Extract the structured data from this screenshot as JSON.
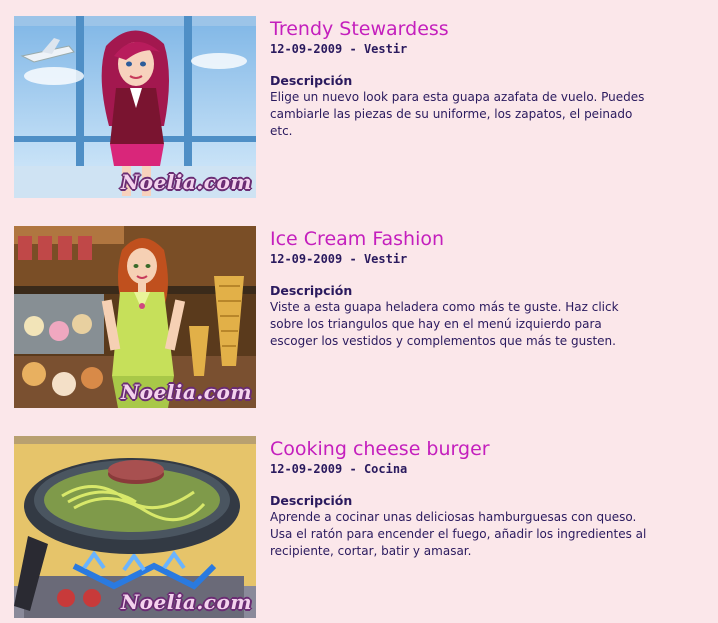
{
  "games": [
    {
      "title": "Trendy Stewardess",
      "date": "12-09-2009",
      "separator": " - ",
      "category": "Vestir",
      "description_label": "Descripción",
      "description": "Elige un nuevo look para esta guapa azafata de vuelo. Puedes\ncambiarle las piezas de su uniforme, los zapatos, el peinado\netc.",
      "logo": "Noelia.com"
    },
    {
      "title": "Ice Cream Fashion",
      "date": "12-09-2009",
      "separator": " - ",
      "category": "Vestir",
      "description_label": "Descripción",
      "description": "Viste a esta guapa heladera como más te guste. Haz click\nsobre los triangulos que hay en el menú izquierdo para\nescoger los vestidos y complementos que más te gusten.",
      "logo": "Noelia.com"
    },
    {
      "title": "Cooking cheese burger",
      "date": "12-09-2009",
      "separator": " - ",
      "category": "Cocina",
      "description_label": "Descripción",
      "description": "Aprende a cocinar unas deliciosas hamburguesas con queso.\nUsa el ratón para encender el fuego, añadir los ingredientes al\nrecipiente, cortar, batir y amasar.",
      "logo": "Noelia.com"
    }
  ],
  "colors": {
    "background": "#fbe7ea",
    "title": "#c41fbd",
    "text": "#2a1a5e"
  }
}
